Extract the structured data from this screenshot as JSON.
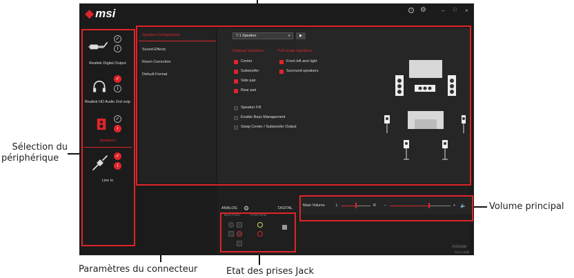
{
  "app": {
    "logo_text": "msi",
    "window_controls": [
      "i",
      "⚙",
      "–",
      "□",
      "×"
    ]
  },
  "devices": [
    {
      "label": "Realtek Digital Output",
      "icon": "digital-output-icon",
      "active": false
    },
    {
      "label": "Realtek HD Audio 2nd outp",
      "icon": "headphones-icon",
      "active": false
    },
    {
      "label": "Speakers",
      "icon": "speakers-icon",
      "active": true
    },
    {
      "label": "Line In",
      "icon": "line-in-icon",
      "active": false
    }
  ],
  "menu": {
    "items": [
      {
        "label": "Speaker Configuration",
        "active": true
      },
      {
        "label": "Sound Effects",
        "active": false
      },
      {
        "label": "Room Correction",
        "active": false
      },
      {
        "label": "Default Format",
        "active": false
      }
    ]
  },
  "config": {
    "dropdown_value": "7.1 Speaker",
    "play_label": "▶",
    "optional_title": "Optional Speakers",
    "fullrange_title": "Full-range Speakers",
    "optional": [
      "Center",
      "Subwoofer",
      "Side pair",
      "Rear pair"
    ],
    "fullrange": [
      "Front left and right",
      "Surround speakers"
    ],
    "options": [
      "Speaker Fill",
      "Enable Bass Management",
      "Swap Center / Subwoofer Output"
    ]
  },
  "connector": {
    "analog_label": "ANALOG",
    "digital_label": "DIGITAL",
    "back_panel": "Back Panel",
    "front_panel": "Front Panel"
  },
  "volume": {
    "label": "Main Volume",
    "left": "L",
    "right": "R",
    "minus": "–",
    "plus": "+",
    "balance": 0.5,
    "level": 0.65
  },
  "watermark": {
    "line1": "Activate",
    "line2": "Go to Setti"
  },
  "annotations": {
    "device_selection": [
      "Sélection du",
      "périphérique"
    ],
    "main_volume": "Volume principal",
    "connector_settings": "Paramètres du connecteur",
    "jack_status": "Etat des prises Jack"
  }
}
